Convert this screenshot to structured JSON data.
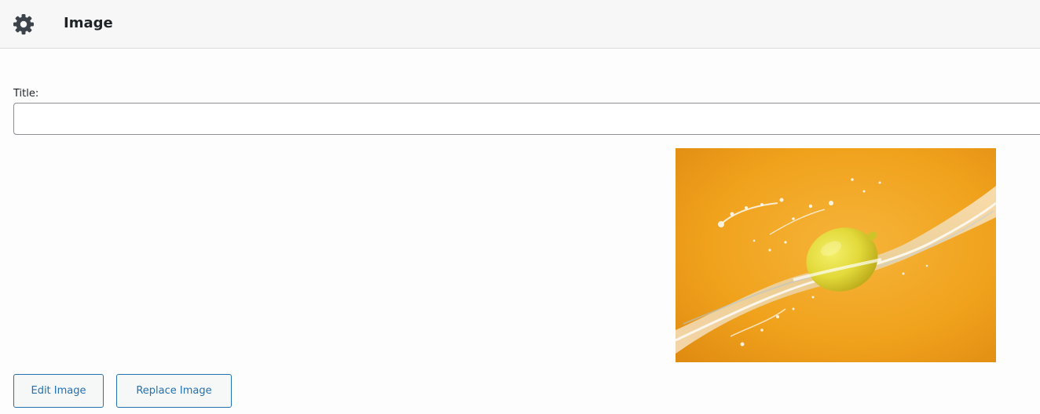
{
  "header": {
    "icon": "gear-icon",
    "title": "Image"
  },
  "form": {
    "title_label": "Title:",
    "title_value": "",
    "title_placeholder": ""
  },
  "preview": {
    "subject": "lemon splash",
    "background_color": "#f0a21c"
  },
  "actions": {
    "edit_label": "Edit Image",
    "replace_label": "Replace Image"
  },
  "colors": {
    "accent": "#2271b1",
    "header_bg": "#f7f7f7"
  }
}
